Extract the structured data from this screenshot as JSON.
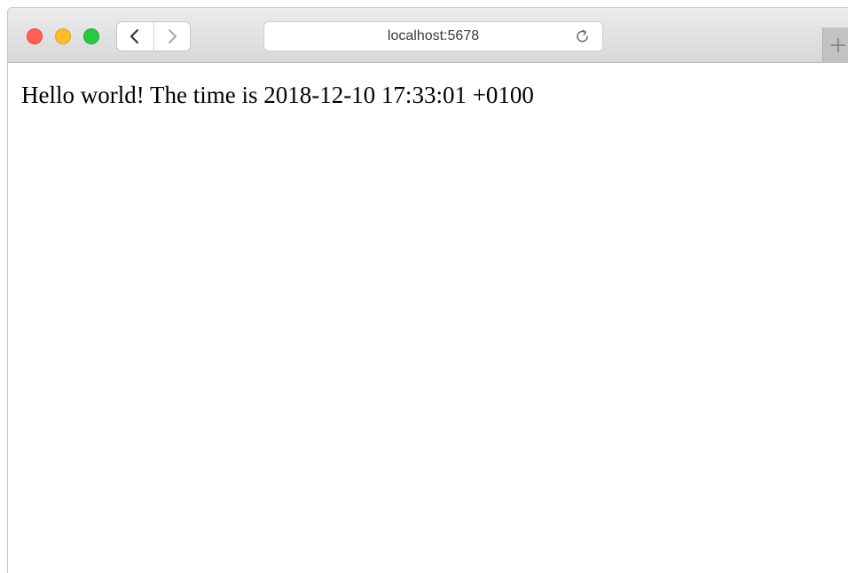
{
  "window_controls": {
    "close": "close-button",
    "minimize": "minimize-button",
    "zoom": "zoom-button"
  },
  "navigation": {
    "back_icon": "chevron-left-icon",
    "forward_icon": "chevron-right-icon"
  },
  "address_bar": {
    "url": "localhost:5678",
    "reload_icon": "reload-icon"
  },
  "new_tab": {
    "icon": "plus-icon"
  },
  "page": {
    "message": "Hello world! The time is 2018-12-10 17:33:01 +0100"
  },
  "colors": {
    "close": "#fe5f57",
    "minimize": "#febc2e",
    "zoom": "#28c840"
  }
}
